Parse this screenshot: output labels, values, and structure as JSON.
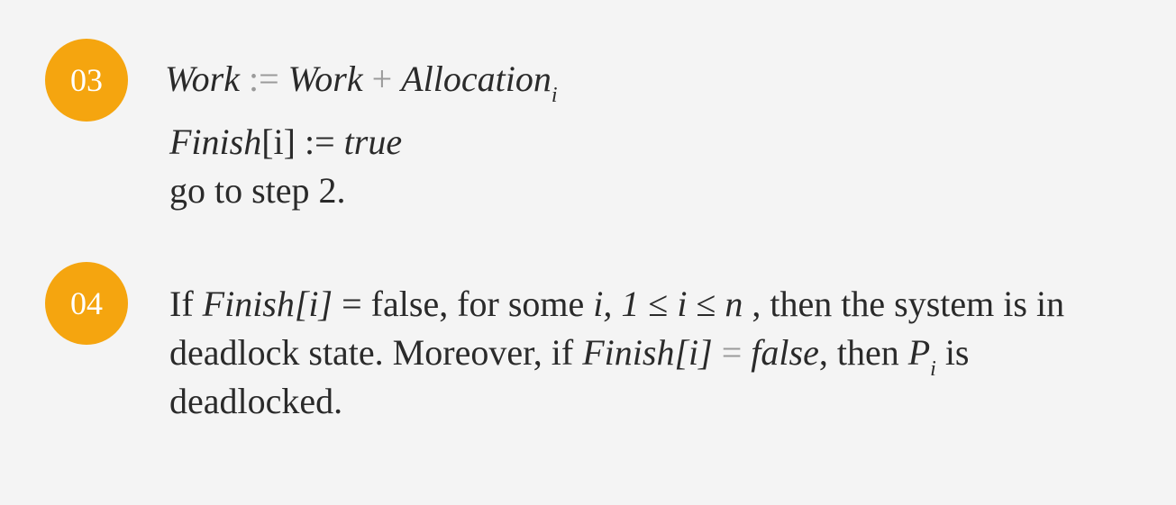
{
  "step3": {
    "number": "03",
    "eq1": {
      "lhs": "Work",
      "op": ":=",
      "rhs1": "Work",
      "plus": "+",
      "rhs2": "Allocation",
      "sub": "i"
    },
    "eq2": {
      "lhs": "Finish",
      "index": "[i]",
      "op": ":=",
      "rhs": "true"
    },
    "goto": "go to step 2."
  },
  "step4": {
    "number": "04",
    "line1": {
      "t1": "If ",
      "finish": "Finish[i]",
      "t2": " = false, for some ",
      "i": "i, ",
      "one": "1",
      "t3": " ≤ ",
      "i2": "i",
      "t4": "  ≤  ",
      "n": "n",
      "t5": " , then the system is in"
    },
    "line2": {
      "t1": "deadlock state. Moreover, if ",
      "finish": "Finish[i]",
      "eq": " = ",
      "false": "false",
      "t2": ", then ",
      "p": "P",
      "sub": "i",
      "t3": " is"
    },
    "line3": "deadlocked."
  }
}
